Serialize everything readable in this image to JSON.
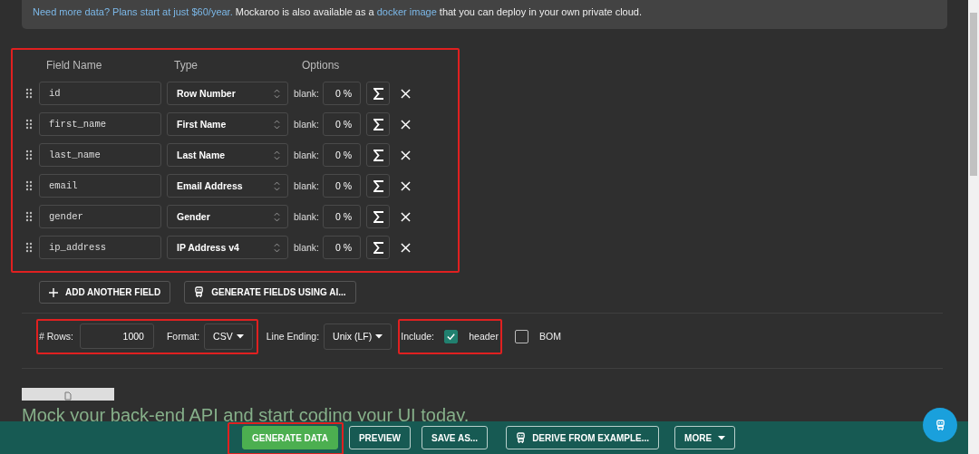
{
  "banner": {
    "link": "Need more data? Plans start at just $60/year.",
    "text_before_link": "Mockaroo is also available as a",
    "link_2": "docker image",
    "text_after": "that you can deploy in your own private cloud."
  },
  "fields": {
    "highlighted": true,
    "columns": [
      "Field Name",
      "Type",
      "Options"
    ],
    "rows": [
      {
        "name": "id",
        "type": "Row Number",
        "blank_label": "blank:",
        "blank": "0 %"
      },
      {
        "name": "first_name",
        "type": "First Name",
        "blank_label": "blank:",
        "blank": "0 %"
      },
      {
        "name": "last_name",
        "type": "Last Name",
        "blank_label": "blank:",
        "blank": "0 %"
      },
      {
        "name": "email",
        "type": "Email Address",
        "blank_label": "blank:",
        "blank": "0 %"
      },
      {
        "name": "gender",
        "type": "Gender",
        "blank_label": "blank:",
        "blank": "0 %"
      },
      {
        "name": "ip_address",
        "type": "IP Address v4",
        "blank_label": "blank:",
        "blank": "0 %"
      }
    ]
  },
  "field_buttons": [
    {
      "kind": "add",
      "label": "ADD ANOTHER FIELD"
    },
    {
      "kind": "ai",
      "label": "GENERATE FIELDS USING AI..."
    }
  ],
  "options": {
    "rows_format_highlighted": true,
    "rows_label": "# Rows:",
    "rows": "1000",
    "format_label": "Format:",
    "format": "CSV",
    "line_ending_label": "Line Ending:",
    "line_ending": "Unix (LF)",
    "include_highlighted": true,
    "include_label": "Include:",
    "checkboxes": [
      {
        "label": "header",
        "checked": true
      },
      {
        "label": "BOM",
        "checked": false
      }
    ]
  },
  "heading": "Mock your back-end API and start coding your UI today.",
  "footer_buttons": [
    {
      "kind": "primary",
      "label": "GENERATE DATA",
      "highlighted": true
    },
    {
      "kind": "plain",
      "label": "PREVIEW",
      "highlighted": false
    },
    {
      "kind": "plain",
      "label": "SAVE AS...",
      "highlighted": false
    },
    {
      "kind": "robot",
      "label": "DERIVE FROM EXAMPLE...",
      "highlighted": false
    },
    {
      "kind": "menu",
      "label": "MORE",
      "highlighted": false
    }
  ]
}
